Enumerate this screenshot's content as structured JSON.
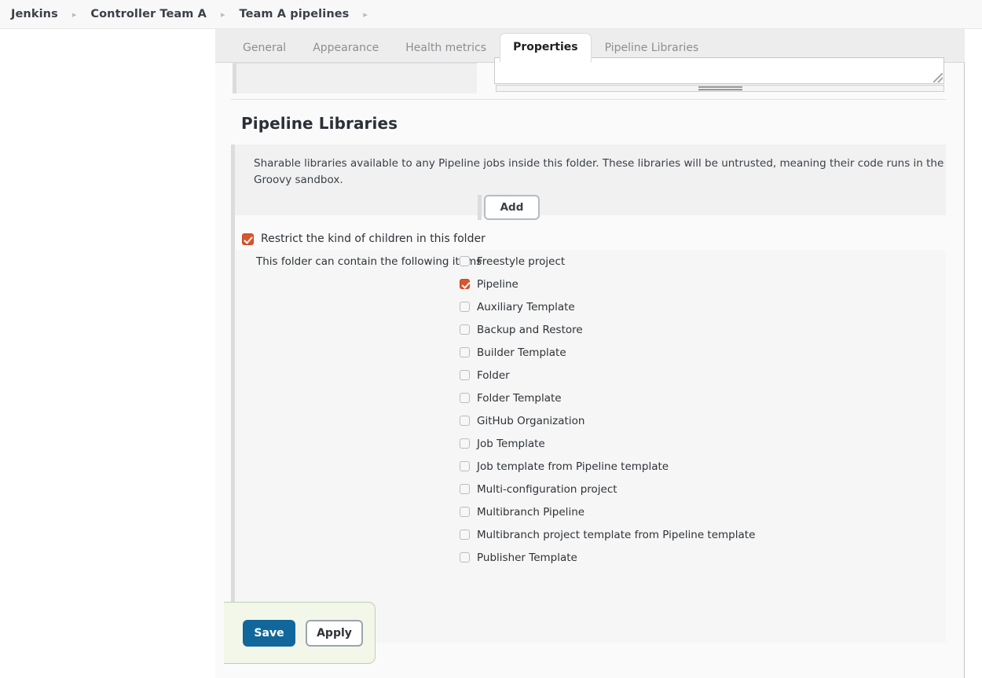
{
  "breadcrumb": {
    "items": [
      {
        "label": "Jenkins"
      },
      {
        "label": "Controller Team A"
      },
      {
        "label": "Team A pipelines"
      }
    ],
    "separator": "▸"
  },
  "tabs": [
    {
      "label": "General",
      "active": false
    },
    {
      "label": "Appearance",
      "active": false
    },
    {
      "label": "Health metrics",
      "active": false
    },
    {
      "label": "Properties",
      "active": true
    },
    {
      "label": "Pipeline Libraries",
      "active": false
    }
  ],
  "section": {
    "heading": "Pipeline Libraries",
    "description": "Sharable libraries available to any Pipeline jobs inside this folder. These libraries will be untrusted, meaning their code runs in the Groovy sandbox.",
    "add_label": "Add"
  },
  "restrict": {
    "label": "Restrict the kind of children in this folder",
    "checked": true
  },
  "items": {
    "label": "This folder can contain the following items",
    "options": [
      {
        "label": "Freestyle project",
        "checked": false
      },
      {
        "label": "Pipeline",
        "checked": true
      },
      {
        "label": "Auxiliary Template",
        "checked": false
      },
      {
        "label": "Backup and Restore",
        "checked": false
      },
      {
        "label": "Builder Template",
        "checked": false
      },
      {
        "label": "Folder",
        "checked": false
      },
      {
        "label": "Folder Template",
        "checked": false
      },
      {
        "label": "GitHub Organization",
        "checked": false
      },
      {
        "label": "Job Template",
        "checked": false
      },
      {
        "label": "Job template from Pipeline template",
        "checked": false
      },
      {
        "label": "Multi-configuration project",
        "checked": false
      },
      {
        "label": "Multibranch Pipeline",
        "checked": false
      },
      {
        "label": "Multibranch project template from Pipeline template",
        "checked": false
      },
      {
        "label": "Publisher Template",
        "checked": false
      }
    ]
  },
  "textarea": {
    "value": ""
  },
  "footer": {
    "save_label": "Save",
    "apply_label": "Apply"
  },
  "colors": {
    "accent_checkbox": "#d9552c",
    "save_button": "#11679c",
    "footer_bar": "#f3f7ea",
    "footer_border": "#bed0ae"
  }
}
